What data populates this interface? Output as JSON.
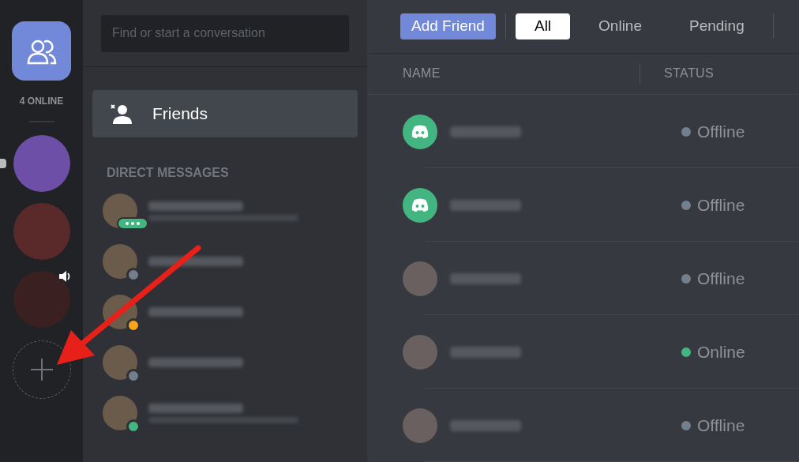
{
  "server_sidebar": {
    "online_count": "4 ONLINE",
    "servers": [
      {
        "kind": "box",
        "unread": true,
        "voice": false
      },
      {
        "kind": "dragon",
        "unread": false,
        "voice": false
      },
      {
        "kind": "lion",
        "unread": false,
        "voice": true
      }
    ]
  },
  "dm_panel": {
    "search": {
      "placeholder": "Find or start a conversation"
    },
    "friends_item": {
      "label": "Friends",
      "selected": true
    },
    "section_title": "DIRECT MESSAGES",
    "conversations": [
      {
        "kind": "typing",
        "has_subtitle": true
      },
      {
        "kind": "offline",
        "has_subtitle": false
      },
      {
        "kind": "idle",
        "has_subtitle": false
      },
      {
        "kind": "offline",
        "has_subtitle": false
      },
      {
        "kind": "online",
        "has_subtitle": true
      }
    ]
  },
  "header": {
    "add_friend": "Add Friend",
    "tabs": [
      {
        "label": "All",
        "selected": true
      },
      {
        "label": "Online",
        "selected": false
      },
      {
        "label": "Pending",
        "selected": false
      }
    ]
  },
  "friends_table": {
    "columns": [
      "NAME",
      "STATUS"
    ],
    "rows": [
      {
        "kind": "default",
        "status": "Offline",
        "online": false
      },
      {
        "kind": "default",
        "status": "Offline",
        "online": false
      },
      {
        "kind": "photo",
        "status": "Offline",
        "online": false
      },
      {
        "kind": "photo",
        "status": "Online",
        "online": true
      },
      {
        "kind": "photo",
        "status": "Offline",
        "online": false
      }
    ]
  }
}
